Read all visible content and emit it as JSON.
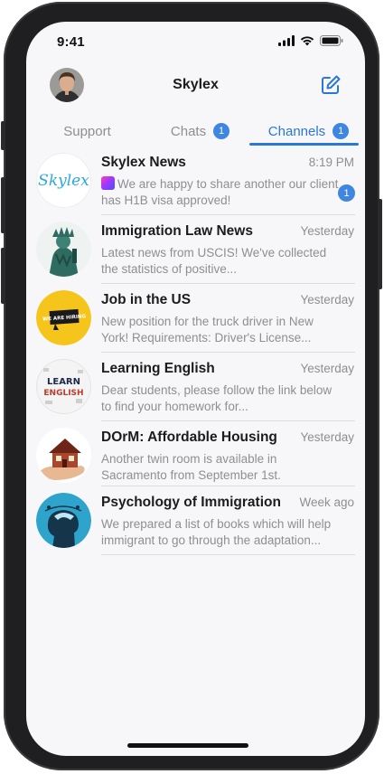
{
  "status_bar": {
    "time": "9:41"
  },
  "header": {
    "title": "Skylex",
    "compose_icon": "compose-icon"
  },
  "tabs": [
    {
      "label": "Support",
      "badge": ""
    },
    {
      "label": "Chats",
      "badge": "1"
    },
    {
      "label": "Channels",
      "badge": "1",
      "active": true
    }
  ],
  "colors": {
    "accent": "#2a78d6",
    "badge": "#3e86e0",
    "muted_text": "#8e8e93"
  },
  "channels": [
    {
      "title": "Skylex News",
      "time": "8:19 PM",
      "preview": "We are happy to share another our client has H1B visa approved!",
      "unread": "1",
      "avatar_text": "Skylex"
    },
    {
      "title": "Immigration Law News",
      "time": "Yesterday",
      "preview": "Latest news from USCIS! We've collected the statistics of positive...",
      "unread": ""
    },
    {
      "title": "Job in the US",
      "time": "Yesterday",
      "preview": "New position for the truck driver in New York! Requirements: Driver's License...",
      "unread": "",
      "avatar_text": "WE ARE HIRING"
    },
    {
      "title": "Learning English",
      "time": "Yesterday",
      "preview": "Dear students, please follow the link below to find your homework for...",
      "unread": "",
      "avatar_text_1": "LEARN",
      "avatar_text_2": "ENGLISH"
    },
    {
      "title": "DOrM: Affordable Housing",
      "time": "Yesterday",
      "preview": "Another twin room is available in Sacramento from September 1st.",
      "unread": ""
    },
    {
      "title": "Psychology of Immigration",
      "time": "Week ago",
      "preview": "We prepared a list of books which will help immigrant to go through the adaptation...",
      "unread": ""
    }
  ]
}
